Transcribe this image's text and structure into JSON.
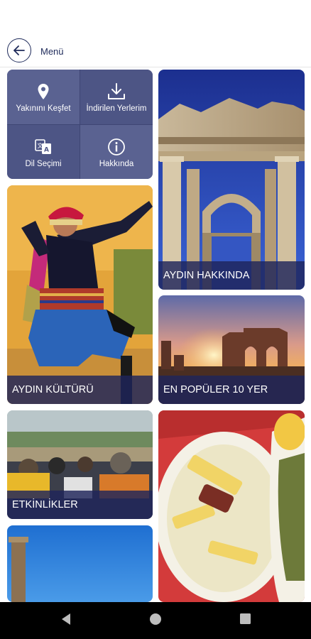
{
  "header": {
    "title": "Menü"
  },
  "menu": {
    "items": [
      {
        "label": "Yakınını Keşfet",
        "icon": "location-pin-icon"
      },
      {
        "label": "İndirilen Yerlerim",
        "icon": "download-icon"
      },
      {
        "label": "Dil Seçimi",
        "icon": "translate-icon"
      },
      {
        "label": "Hakkında",
        "icon": "info-icon"
      }
    ]
  },
  "cards": {
    "about": "AYDIN HAKKINDA",
    "culture": "AYDIN KÜLTÜRÜ",
    "top10": "EN POPÜLER 10 YER",
    "events": "ETKİNLİKLER"
  },
  "colors": {
    "primary": "#1e2a5a",
    "menu_bg": "#4d5585",
    "overlay": "#1e245a"
  }
}
